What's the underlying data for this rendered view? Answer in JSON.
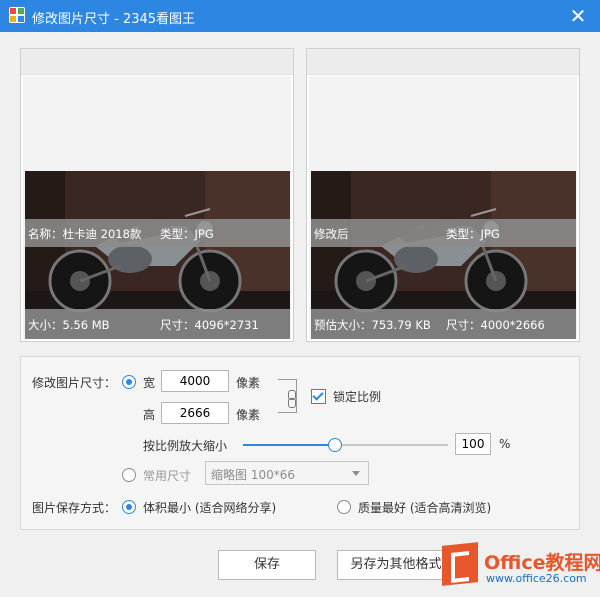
{
  "window": {
    "title": "修改图片尺寸 - 2345看图王",
    "close": "✕"
  },
  "original": {
    "name": "名称：杜卡迪 2018款",
    "type": "类型：JPG",
    "size": "大小：5.56 MB",
    "dimensions": "尺寸：4096*2731"
  },
  "modified": {
    "name": "修改后",
    "type": "类型：JPG",
    "size": "预估大小：753.79 KB",
    "dimensions": "尺寸：4000*2666"
  },
  "resize": {
    "label": "修改图片尺寸：",
    "width_label": "宽",
    "width_value": "4000",
    "height_label": "高",
    "height_value": "2666",
    "unit": "像素",
    "lock_label": "锁定比例",
    "scale_label": "按比例放大缩小",
    "scale_value": "100",
    "scale_fraction": 0.45,
    "percent": "%",
    "common_label": "常用尺寸",
    "common_selected": "缩略图 100*66"
  },
  "save_mode": {
    "label": "图片保存方式：",
    "opt1": "体积最小 (适合网络分享)",
    "opt2": "质量最好 (适合高清浏览)"
  },
  "buttons": {
    "save": "保存",
    "save_as": "另存为其他格式"
  },
  "watermark": {
    "title": "Office教程网",
    "url": "www.office26.com"
  },
  "colors": {
    "accent": "#2d87e2",
    "brand": "#e8572b"
  }
}
